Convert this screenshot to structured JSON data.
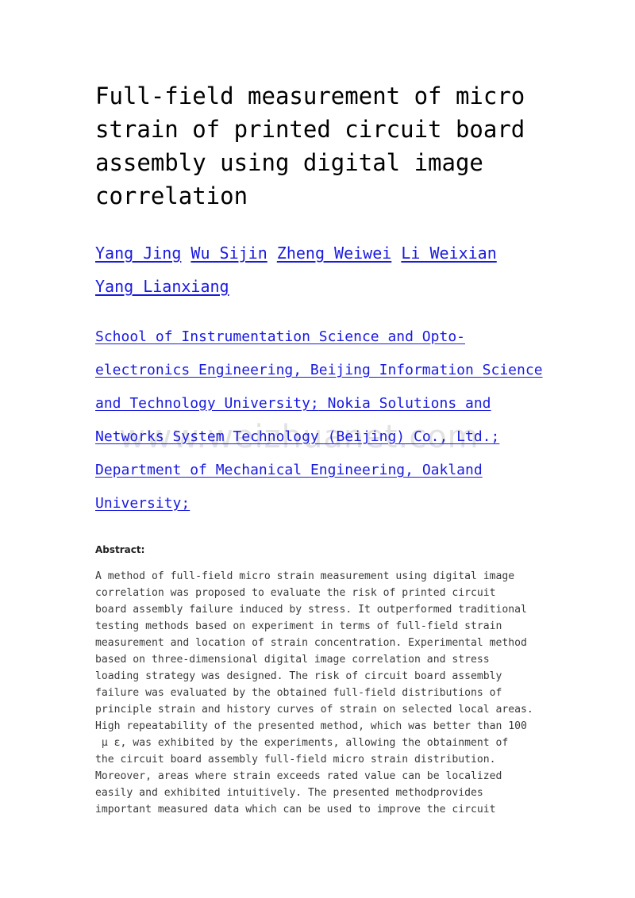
{
  "document": {
    "title": "Full-field measurement of micro strain of printed circuit board assembly using digital image correlation",
    "watermark": "www.weizhuanet.com",
    "colors": {
      "link": "#1a1ae0",
      "text": "#000000",
      "abstract_text": "#3a3a3a",
      "watermark": "#e2e2e2",
      "background": "#ffffff"
    }
  },
  "title_lines": [
    "Full-field measurement of micro",
    "strain of printed circuit board",
    "assembly using digital image",
    "correlation"
  ],
  "authors": [
    "Yang Jing",
    "Wu Sijin",
    "Zheng Weiwei",
    "Li Weixian",
    "Yang Lianxiang"
  ],
  "affiliation_lines": [
    "School of Instrumentation Science and Opto-",
    "electronics Engineering, Beijing Information ",
    "Science and Technology University;",
    " Nokia ",
    "Solutions and Networks System Technology ",
    "(Beijing) Co., Ltd.;",
    " Department of Mechanical ",
    "Engineering, Oakland University;"
  ],
  "affiliations": [
    "School of Instrumentation Science and Opto-electronics Engineering, Beijing Information Science and Technology University;",
    "Nokia Solutions and Networks System Technology (Beijing) Co., Ltd.;",
    "Department of Mechanical Engineering, Oakland University;"
  ],
  "abstract": {
    "label": "Abstract:",
    "body": "A method of full-field micro strain measurement using digital image\ncorrelation was proposed to evaluate the risk of printed circuit\nboard assembly failure induced by stress. It outperformed traditional\ntesting methods based on experiment in terms of full-field strain\nmeasurement and location of strain concentration. Experimental method\nbased on three-dimensional digital image correlation and stress\nloading strategy was designed. The risk of circuit board assembly\nfailure was evaluated by the obtained full-field distributions of\nprinciple strain and history curves of strain on selected local areas.\nHigh repeatability of the presented method, which was better than 100\n μ ε, was exhibited by the experiments, allowing the obtainment of\nthe circuit board assembly full-field micro strain distribution.\nMoreover, areas where strain exceeds rated value can be localized\neasily and exhibited intuitively. The presented methodprovides\nimportant measured data which can be used to improve the circuit"
  }
}
